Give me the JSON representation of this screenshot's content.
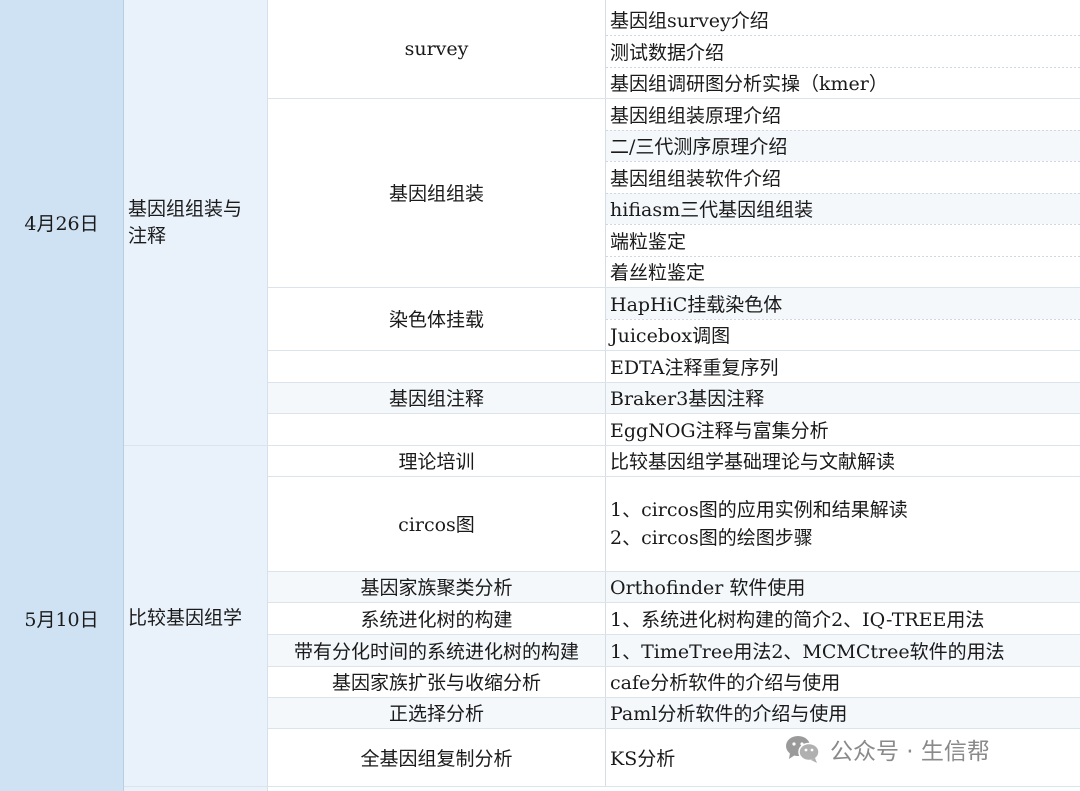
{
  "groups": [
    {
      "date": "4月26日",
      "module": "基因组组装与注释"
    },
    {
      "date": "5月10日",
      "module": "比较基因组学"
    }
  ],
  "topics": {
    "survey": "survey",
    "assembly": "基因组组装",
    "chromosome": "染色体挂载",
    "annotation": "基因组注释",
    "theory": "理论培训",
    "circos": "circos图",
    "family_cluster": "基因家族聚类分析",
    "phylo_tree": "系统进化树的构建",
    "dated_tree": "带有分化时间的系统进化树的构建",
    "family_expansion": "基因家族扩张与收缩分析",
    "positive_selection": "正选择分析",
    "wgd": "全基因组复制分析"
  },
  "details": {
    "survey_intro": "基因组survey介绍",
    "test_data": "测试数据介绍",
    "kmer": "基因组调研图分析实操（kmer）",
    "assembly_principle": "基因组组装原理介绍",
    "sequencing_principle": "二/三代测序原理介绍",
    "assembly_software": "基因组组装软件介绍",
    "hifiasm": "hifiasm三代基因组组装",
    "telomere": "端粒鉴定",
    "centromere": "着丝粒鉴定",
    "haphic": "HapHiC挂载染色体",
    "juicebox": "Juicebox调图",
    "edta": "EDTA注释重复序列",
    "braker3": "Braker3基因注释",
    "eggnog": "EggNOG注释与富集分析",
    "comparative_theory": "比较基因组学基础理论与文献解读",
    "circos_1": "1、circos图的应用实例和结果解读",
    "circos_2": "2、circos图的绘图步骤",
    "orthofinder": "Orthofinder 软件使用",
    "iqtree": "1、系统进化树构建的简介2、IQ-TREE用法",
    "timetree": "1、TimeTree用法2、MCMCtree软件的用法",
    "cafe": "cafe分析软件的介绍与使用",
    "paml": "Paml分析软件的介绍与使用",
    "ks": "KS分析"
  },
  "watermark": {
    "text": "公众号 · 生信帮",
    "icon": "wechat-icon"
  },
  "colors": {
    "date_bg": "#cfe2f3",
    "module_bg": "#e9f2fb",
    "row_shade": "#f4f8fb"
  }
}
